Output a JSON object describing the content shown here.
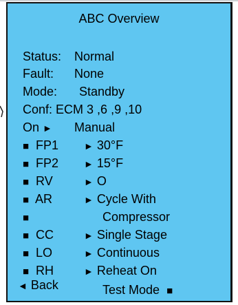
{
  "screen": {
    "title": "ABC Overview",
    "status": {
      "label": "Status:",
      "value": "Normal"
    },
    "fault": {
      "label": "Fault:",
      "value": "None"
    },
    "mode": {
      "label": "Mode:",
      "value": "Standby"
    },
    "conf": {
      "label": "Conf:",
      "value": "ECM 3 ,6 ,9 ,10"
    },
    "on_row": {
      "label": "On",
      "arrow": "►",
      "value": "Manual"
    },
    "items": [
      {
        "bullet": "■",
        "name": "FP1",
        "arrow": "►",
        "value": "30°F"
      },
      {
        "bullet": "■",
        "name": "FP2",
        "arrow": "►",
        "value": "15°F"
      },
      {
        "bullet": "■",
        "name": "RV",
        "arrow": "►",
        "value": "O"
      },
      {
        "bullet": "■",
        "name": "AR",
        "arrow": "►",
        "value": "Cycle With"
      },
      {
        "bullet": "■",
        "name": "",
        "arrow": "",
        "value": "Compressor"
      },
      {
        "bullet": "■",
        "name": "CC",
        "arrow": "►",
        "value": "Single Stage"
      },
      {
        "bullet": "■",
        "name": "LO",
        "arrow": "►",
        "value": "Continuous"
      },
      {
        "bullet": "■",
        "name": "RH",
        "arrow": "►",
        "value": "Reheat On"
      }
    ],
    "back": {
      "arrow": "◄",
      "label": "Back"
    },
    "test_mode": {
      "label": "Test Mode",
      "bullet": "■"
    }
  },
  "colors": {
    "screen_background": "#5fc6f1",
    "text": "#000000",
    "border": "#111111"
  }
}
